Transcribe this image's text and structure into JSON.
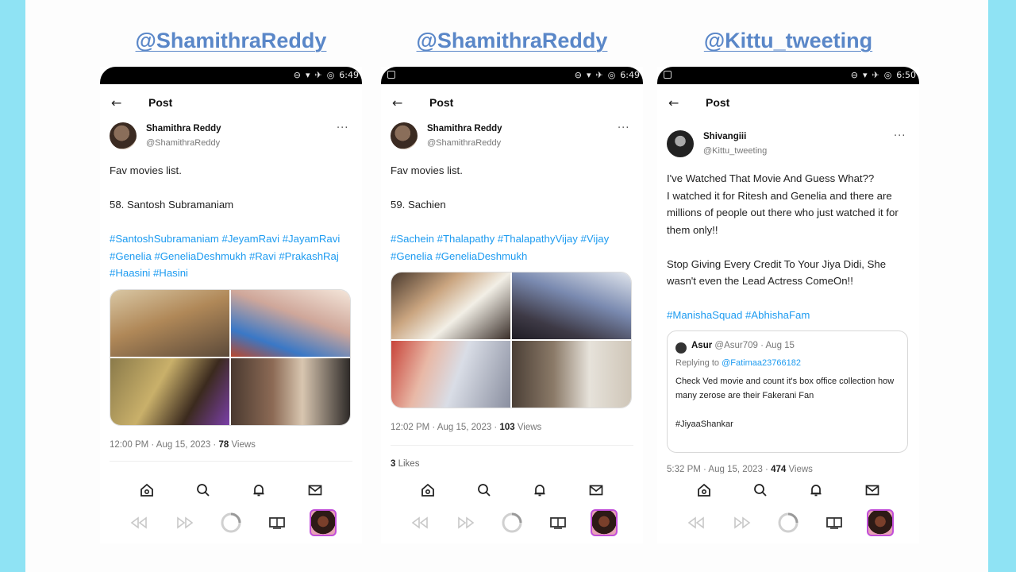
{
  "colors": {
    "handle": "#5a87c8",
    "hashtag": "#1d9bf0",
    "background": "#8fe3f4"
  },
  "panels": [
    {
      "handle_label": "@ShamithraReddy",
      "status_time": "6:49",
      "header": {
        "back_icon": "arrow-left-icon",
        "title": "Post"
      },
      "author": {
        "name": "Shamithra Reddy",
        "handle": "@ShamithraReddy"
      },
      "text": "Fav movies list.\n\n58. Santosh Subramaniam",
      "hashtags": "#SantoshSubramaniam #JeyamRavi #JayamRavi #Genelia #GeneliaDeshmukh #Ravi #PrakashRaj #Haasini #Hasini",
      "time": "12:00 PM · Aug 15, 2023 · ",
      "views_count": "78",
      "views_label": " Views",
      "likes_count": "",
      "likes_label": ""
    },
    {
      "handle_label": "@ShamithraReddy",
      "status_time": "6:49",
      "header": {
        "back_icon": "arrow-left-icon",
        "title": "Post"
      },
      "author": {
        "name": "Shamithra Reddy",
        "handle": "@ShamithraReddy"
      },
      "text": "Fav movies list.\n\n59. Sachien",
      "hashtags": "#Sachein #Thalapathy #ThalapathyVijay #Vijay #Genelia #GeneliaDeshmukh",
      "time": "12:02 PM · Aug 15, 2023 · ",
      "views_count": "103",
      "views_label": " Views",
      "likes_count": "3",
      "likes_label": " Likes"
    },
    {
      "handle_label": "@Kittu_tweeting",
      "status_time": "6:50",
      "header": {
        "back_icon": "arrow-left-icon",
        "title": "Post"
      },
      "author": {
        "name": "Shivangiii",
        "handle": "@Kittu_tweeting"
      },
      "text": "I've Watched That Movie And Guess What??\nI watched it for Ritesh and Genelia and there are millions of people out there who just watched it for them only!!\n\nStop Giving Every Credit To Your Jiya Didi, She wasn't even the Lead Actress ComeOn!!",
      "hashtags": "#ManishaSquad #AbhishaFam",
      "quote": {
        "name": "Asur",
        "handle_date": "@Asur709 · Aug 15",
        "reply_prefix": "Replying to ",
        "reply_to": "@Fatimaa23766182",
        "text": "Check Ved movie and count it's box office collection how many zerose are their Fakerani Fan\n\n#JiyaaShankar"
      },
      "time": "5:32 PM · Aug 15, 2023 · ",
      "views_count": "474",
      "views_label": " Views",
      "likes_count": "",
      "likes_label": ""
    }
  ],
  "nav_icons": [
    "home-icon",
    "search-icon",
    "notifications-bell-icon",
    "messages-envelope-icon"
  ],
  "controls_icons": [
    "rewind-icon",
    "fast-forward-icon",
    "loading-spinner-icon",
    "cast-screen-icon",
    "profile-avatar"
  ]
}
